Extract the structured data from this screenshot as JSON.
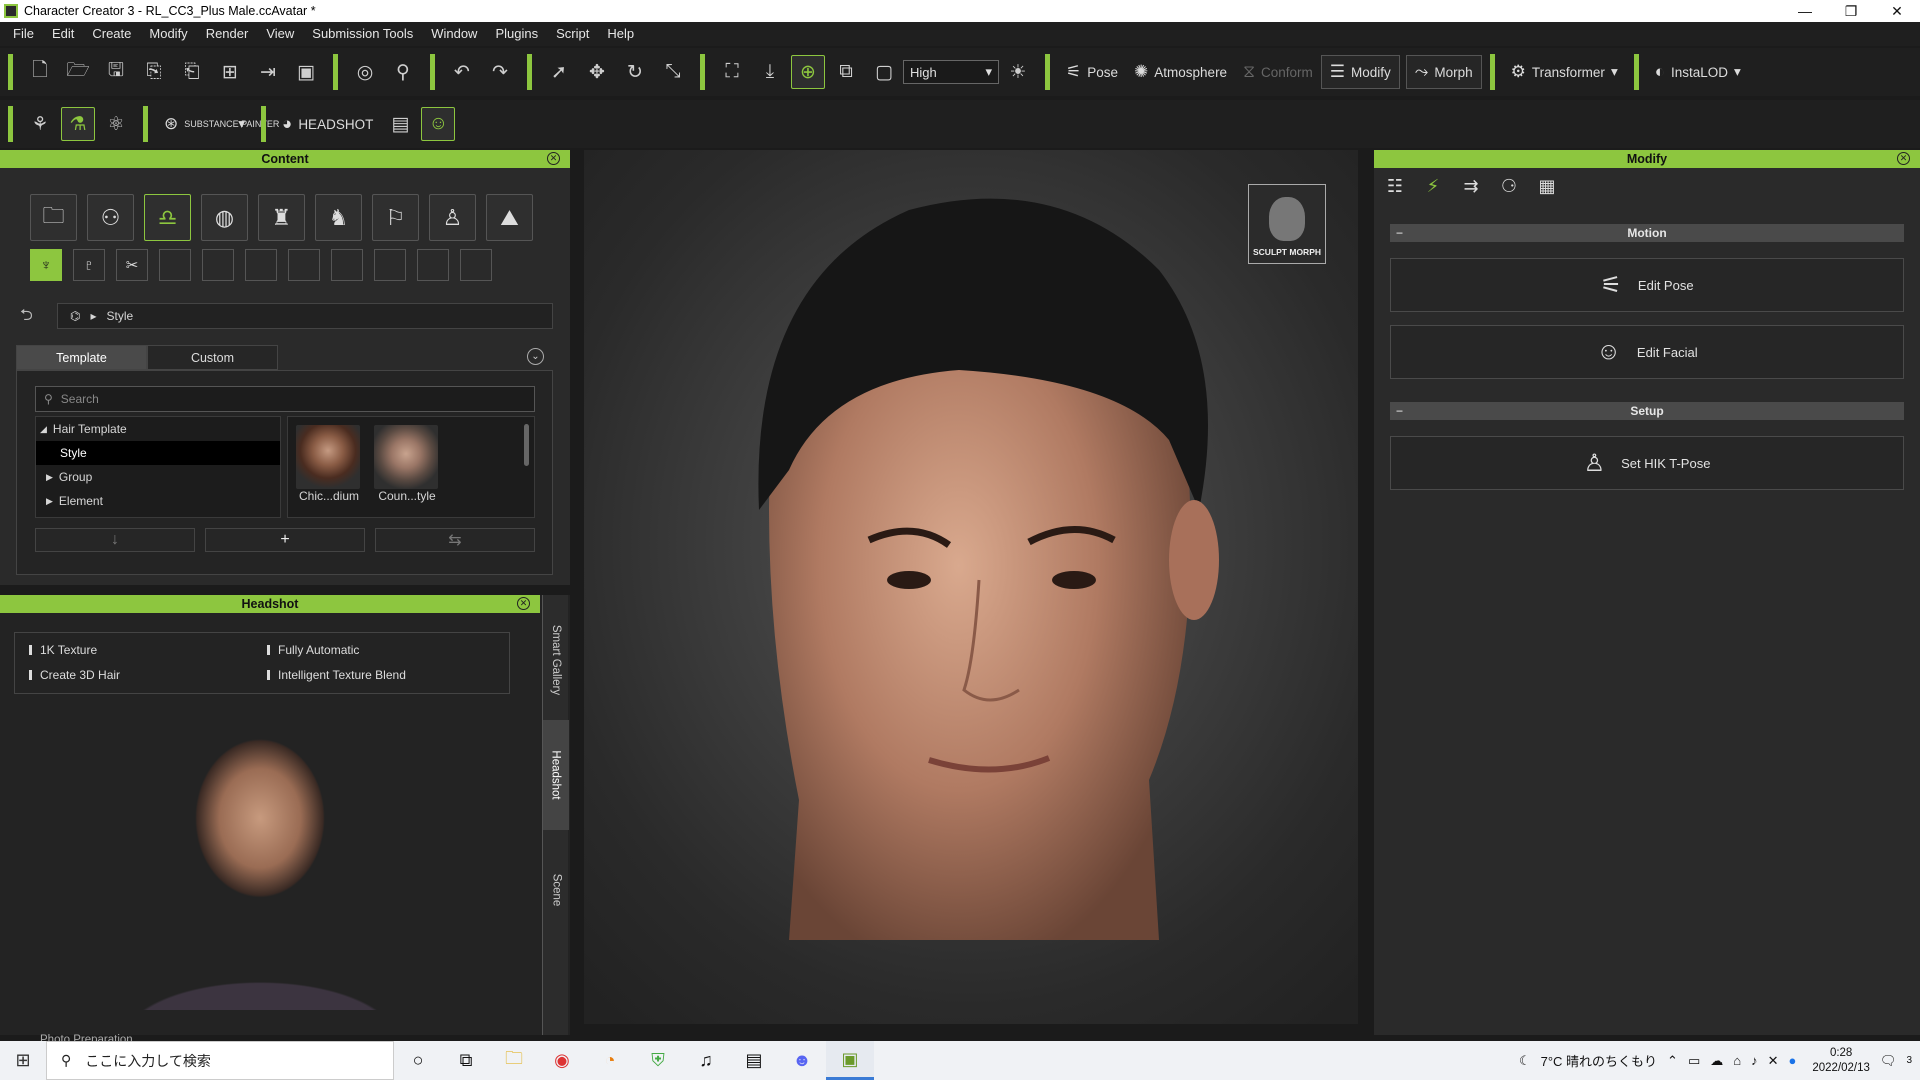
{
  "window": {
    "title": "Character Creator 3 - RL_CC3_Plus Male.ccAvatar *",
    "min": "—",
    "max": "❐",
    "close": "✕"
  },
  "menu": [
    "File",
    "Edit",
    "Create",
    "Modify",
    "Render",
    "View",
    "Submission Tools",
    "Window",
    "Plugins",
    "Script",
    "Help"
  ],
  "toolbar": {
    "quality": "High",
    "pose": "Pose",
    "atmosphere": "Atmosphere",
    "conform": "Conform",
    "modify": "Modify",
    "morph": "Morph",
    "transformer": "Transformer",
    "instalod": "InstaLOD",
    "substance": "SUBSTANCE PAINTER",
    "headshot": "HEADSHOT"
  },
  "content": {
    "header": "Content",
    "breadcrumb": "Style",
    "tabs": [
      "Template",
      "Custom"
    ],
    "search_placeholder": "Search",
    "tree": [
      "Hair Template",
      "Style",
      "Group",
      "Element"
    ],
    "thumbs": [
      "Chic...dium",
      "Coun...tyle"
    ]
  },
  "headshot": {
    "header": "Headshot",
    "features": [
      "1K Texture",
      "Fully Automatic",
      "Create 3D Hair",
      "Intelligent Texture Blend"
    ],
    "side_tabs": [
      "Smart Gallery",
      "Headshot",
      "Scene"
    ],
    "footer": "Photo Preparation"
  },
  "viewport": {
    "sculpt_label": "SCULPT MORPH"
  },
  "modify": {
    "header": "Modify",
    "motion": "Motion",
    "edit_pose": "Edit Pose",
    "edit_facial": "Edit Facial",
    "setup": "Setup",
    "set_hik": "Set HIK T-Pose"
  },
  "taskbar": {
    "search": "ここに入力して検索",
    "weather": "7°C  晴れのちくもり",
    "time": "0:28",
    "date": "2022/02/13",
    "notif": "3"
  }
}
